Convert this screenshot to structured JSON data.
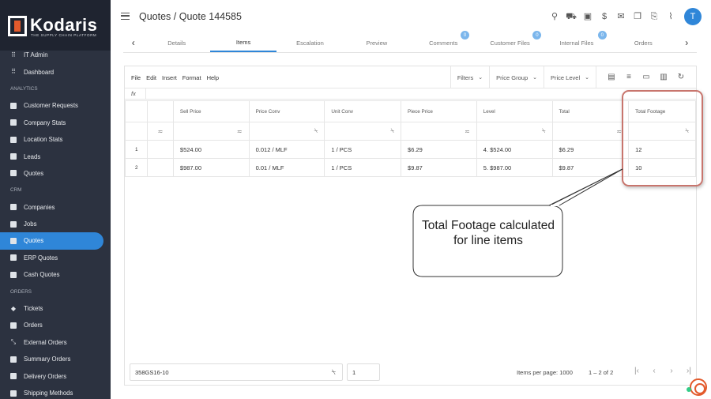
{
  "brand": {
    "name": "Kodaris",
    "tagline": "THE SUPPLY CHAIN PLATFORM"
  },
  "sidebar": {
    "groups": [
      {
        "items": [
          {
            "label": "IT Admin",
            "icon": "grid-icon"
          },
          {
            "label": "Dashboard",
            "icon": "grid-icon"
          }
        ]
      },
      {
        "title": "ANALYTICS",
        "items": [
          {
            "label": "Customer Requests",
            "icon": "chart-icon"
          },
          {
            "label": "Company Stats",
            "icon": "chart-icon"
          },
          {
            "label": "Location Stats",
            "icon": "chart-icon"
          },
          {
            "label": "Leads",
            "icon": "chart-icon"
          },
          {
            "label": "Quotes",
            "icon": "chart-icon"
          }
        ]
      },
      {
        "title": "CRM",
        "items": [
          {
            "label": "Companies",
            "icon": "building-icon"
          },
          {
            "label": "Jobs",
            "icon": "briefcase-icon"
          },
          {
            "label": "Quotes",
            "icon": "document-icon",
            "active": true
          },
          {
            "label": "ERP Quotes",
            "icon": "document-icon"
          },
          {
            "label": "Cash Quotes",
            "icon": "document-icon"
          }
        ]
      },
      {
        "title": "ORDERS",
        "items": [
          {
            "label": "Tickets",
            "icon": "tag-icon"
          },
          {
            "label": "Orders",
            "icon": "truck-icon"
          },
          {
            "label": "External Orders",
            "icon": "shrink-icon"
          },
          {
            "label": "Summary Orders",
            "icon": "truck-icon"
          },
          {
            "label": "Delivery Orders",
            "icon": "truck-icon"
          },
          {
            "label": "Shipping Methods",
            "icon": "truck-icon"
          }
        ]
      }
    ]
  },
  "header": {
    "title": "Quotes / Quote 144585",
    "avatar_initial": "T"
  },
  "tabs": [
    {
      "label": "Details"
    },
    {
      "label": "Items",
      "active": true
    },
    {
      "label": "Escalation"
    },
    {
      "label": "Preview"
    },
    {
      "label": "Comments",
      "badge": "0"
    },
    {
      "label": "Customer Files",
      "badge": "0"
    },
    {
      "label": "Internal Files",
      "badge": "0"
    },
    {
      "label": "Orders"
    }
  ],
  "menubar": {
    "menu": [
      "File",
      "Edit",
      "Insert",
      "Format",
      "Help"
    ],
    "filters": "Filters",
    "price_group": "Price Group",
    "price_level": "Price Level"
  },
  "formula_label": "fx",
  "grid": {
    "columns": [
      "",
      "Sell Price",
      "Price Conv",
      "Unit Conv",
      "Piece Price",
      "Level",
      "Total",
      "Total Footage"
    ],
    "rows": [
      [
        "1",
        "$524.00",
        "0.012 / MLF",
        "1 / PCS",
        "$6.29",
        "4. $524.00",
        "$6.29",
        "12"
      ],
      [
        "2",
        "$987.00",
        "0.01 / MLF",
        "1 / PCS",
        "$9.87",
        "5. $987.00",
        "$9.87",
        "10"
      ]
    ]
  },
  "callout": {
    "text": "Total Footage calculated for line items"
  },
  "footer": {
    "item_code": "358GS16-10",
    "page": "1",
    "items_per_page": "Items per page: 1000",
    "range": "1 – 2 of 2"
  },
  "colors": {
    "sidebar": "#2c3240",
    "accent": "#2f86d8",
    "highlight": "#c8756d",
    "brand_orange": "#e35a2c"
  }
}
